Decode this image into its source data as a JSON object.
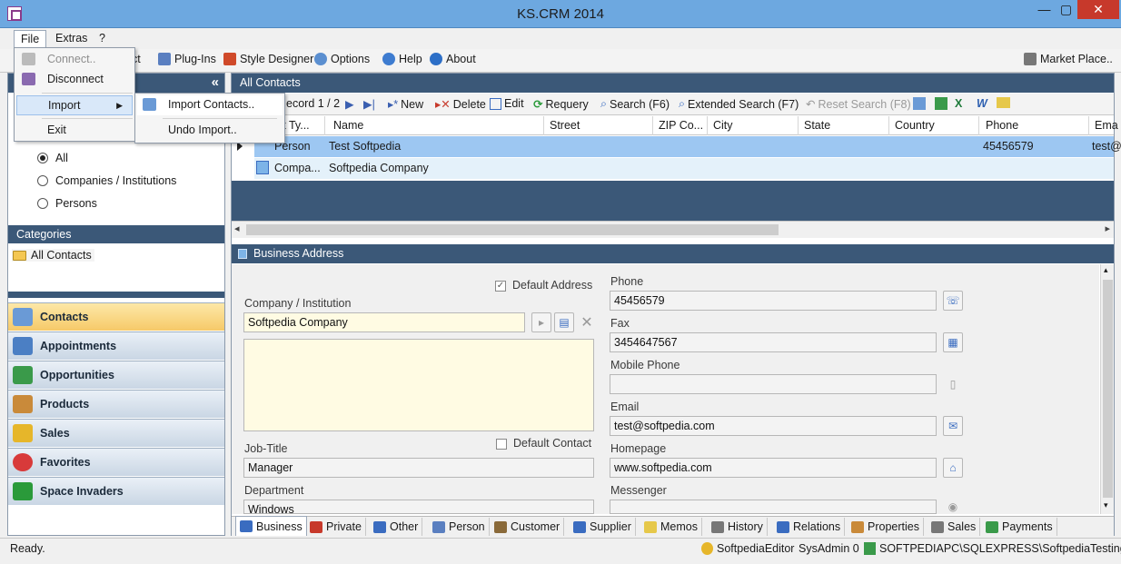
{
  "window": {
    "title": "KS.CRM 2014",
    "min": "—",
    "max": "▢",
    "close": "✕"
  },
  "menubar": {
    "file": "File",
    "extras": "Extras",
    "help": "?"
  },
  "toolbar": {
    "contact_partial": "ct",
    "plugins": "Plug-Ins",
    "style_designer": "Style Designer",
    "options": "Options",
    "help": "Help",
    "about": "About",
    "market_place": "Market Place.."
  },
  "file_menu": {
    "connect": "Connect..",
    "disconnect": "Disconnect",
    "import": "Import",
    "exit": "Exit"
  },
  "import_submenu": {
    "import_contacts": "Import Contacts..",
    "undo_import": "Undo Import.."
  },
  "left": {
    "collapse": "«",
    "filters": [
      "All",
      "Companies / Institutions",
      "Persons"
    ],
    "categories_title": "Categories",
    "category_item": "All Contacts",
    "nav": [
      "Contacts",
      "Appointments",
      "Opportunities",
      "Products",
      "Sales",
      "Favorites",
      "Space Invaders"
    ]
  },
  "grid": {
    "title": "All Contacts",
    "record": "ecord 1 / 2",
    "new": "New",
    "delete": "Delete",
    "edit": "Edit",
    "requery": "Requery",
    "search": "Search (F6)",
    "extended_search": "Extended Search (F7)",
    "reset_search": "Reset Search (F8)",
    "columns": [
      "ct Ty...",
      "Name",
      "Street",
      "ZIP Co...",
      "City",
      "State",
      "Country",
      "Phone",
      "Ema"
    ],
    "rows": [
      {
        "type": "Person",
        "name": "Test Softpedia",
        "phone": "45456579",
        "email": "test@"
      },
      {
        "type": "Compa...",
        "name": "Softpedia Company",
        "phone": "",
        "email": ""
      }
    ]
  },
  "address": {
    "title": "Business Address",
    "default_address": "Default Address",
    "company_label": "Company / Institution",
    "company_value": "Softpedia Company",
    "job_label": "Job-Title",
    "job_value": "Manager",
    "default_contact": "Default Contact",
    "dept_label": "Department",
    "dept_value": "Windows",
    "phone_label": "Phone",
    "phone_value": "45456579",
    "fax_label": "Fax",
    "fax_value": "3454647567",
    "mobile_label": "Mobile Phone",
    "mobile_value": "",
    "email_label": "Email",
    "email_value": "test@softpedia.com",
    "homepage_label": "Homepage",
    "homepage_value": "www.softpedia.com",
    "messenger_label": "Messenger",
    "messenger_value": ""
  },
  "tabs": [
    "Business",
    "Private",
    "Other",
    "Person",
    "Customer",
    "Supplier",
    "Memos",
    "History",
    "Relations",
    "Properties",
    "Sales",
    "Payments"
  ],
  "status": {
    "ready": "Ready.",
    "user": "SoftpediaEditor",
    "role": "SysAdmin 0",
    "db": "SOFTPEDIAPC\\SQLEXPRESS\\SoftpediaTesting"
  },
  "colors": {
    "panel_header": "#3b5878",
    "title_bar": "#6da8e0",
    "selected_row": "#9dc7f2",
    "active_nav": "#f6c968"
  }
}
